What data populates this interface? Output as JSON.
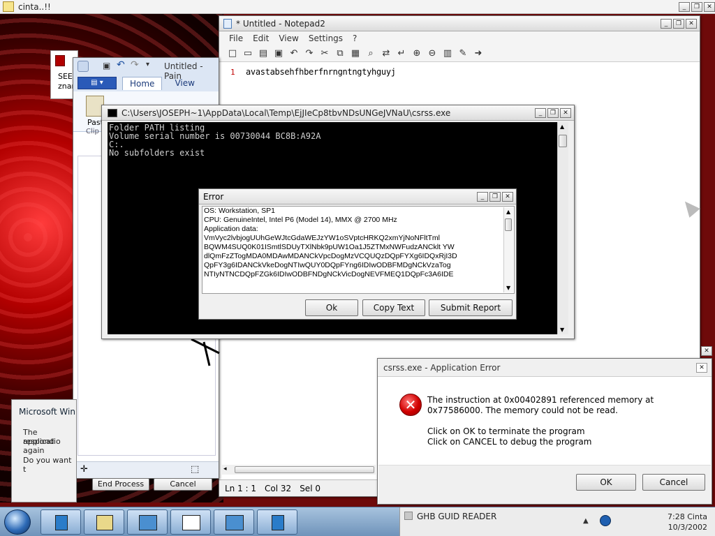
{
  "desktop": {
    "top_window_title": "cinta..!!"
  },
  "notepad": {
    "title": "* Untitled - Notepad2",
    "menu": [
      "File",
      "Edit",
      "View",
      "Settings",
      "?"
    ],
    "line_number": "1",
    "content": "avastabsehfhberfnrngntngtyhguyj",
    "status": {
      "pos": "Ln 1 : 1",
      "col": "Col 32",
      "sel": "Sel 0"
    }
  },
  "paint": {
    "title": "Untitled - Pain",
    "tabs": [
      "Home",
      "View"
    ],
    "paste_label": "Past",
    "clip_label": "Clip"
  },
  "seek": {
    "line1": "SEE",
    "line2": "znar"
  },
  "console": {
    "title": "C:\\Users\\JOSEPH~1\\AppData\\Local\\Temp\\EjJIeCp8tbvNDsUNGeJVNaU\\csrss.exe",
    "output": "Folder PATH listing\nVolume serial number is 00730044 BC8B:A92A\nC:.\nNo subfolders exist"
  },
  "error_dialog": {
    "title": "Error",
    "lines": [
      "OS:  Workstation, SP1",
      "CPU: GenuineIntel, Intel P6 (Model 14), MMX @ 2700 MHz",
      "",
      "Application data:",
      "VmVyc2lvbjogUUhGeWJtcGdaWEJzYW1oSVptcHRKQ2xmYjNoNFltTml",
      "BQWM4SUQ0K01ISmtlSDUyTXlNbk9pUW1Oa1J5ZTMxNWFudzANCklt YW",
      "dlQmFzZTogMDA0MDAwMDANCkVpcDogMzVCQUQzDQpFYXg6IDQxRjI3D",
      "QpFY3g6IDANCkVkeDogNTIwQUY0DQpFYng6IDIwODBFMDgNCkVzaTog",
      "NTIyNTNCDQpFZGk6IDIwODBFNDgNCkVicDogNEVFMEQ1DQpFc3A6IDE"
    ],
    "buttons": {
      "ok": "Ok",
      "copy": "Copy Text",
      "submit": "Submit Report"
    }
  },
  "app_error": {
    "title": "csrss.exe - Application Error",
    "message1": "The instruction at 0x00402891 referenced memory at 0x77586000. The memory could not be read.",
    "message2": "Click on OK to terminate the program",
    "message3": "Click on CANCEL to debug the program",
    "ok": "OK",
    "cancel": "Cancel"
  },
  "ms_dialog": {
    "title": "Microsoft Win",
    "line1": "The applicatio",
    "line2": "respond again",
    "line3": "Do you want t",
    "end_process": "End Process",
    "cancel": "Cancel"
  },
  "taskbar": {
    "tray_app": "GHB GUID READER",
    "time": "7:28 Cinta",
    "date": "10/3/2002"
  }
}
